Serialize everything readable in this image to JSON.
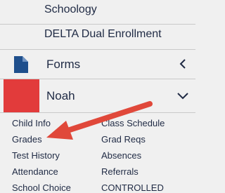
{
  "menu": {
    "top_links": [
      "Schoology",
      "DELTA Dual Enrollment"
    ],
    "forms": {
      "label": "Forms",
      "icon": "document-icon"
    },
    "student": {
      "name": "Noah",
      "avatar_color": "#e23b3b"
    },
    "student_links": {
      "col1": [
        "Child Info",
        "Grades",
        "Test History",
        "Attendance",
        "School Choice"
      ],
      "col2": [
        "Class Schedule",
        "Grad Reqs",
        "Absences",
        "Referrals",
        "CONTROLLED"
      ]
    }
  },
  "colors": {
    "background": "#f0f0f0",
    "text": "#1f2a44",
    "icon": "#1f4f8c",
    "annotation_arrow": "#e0483a"
  }
}
